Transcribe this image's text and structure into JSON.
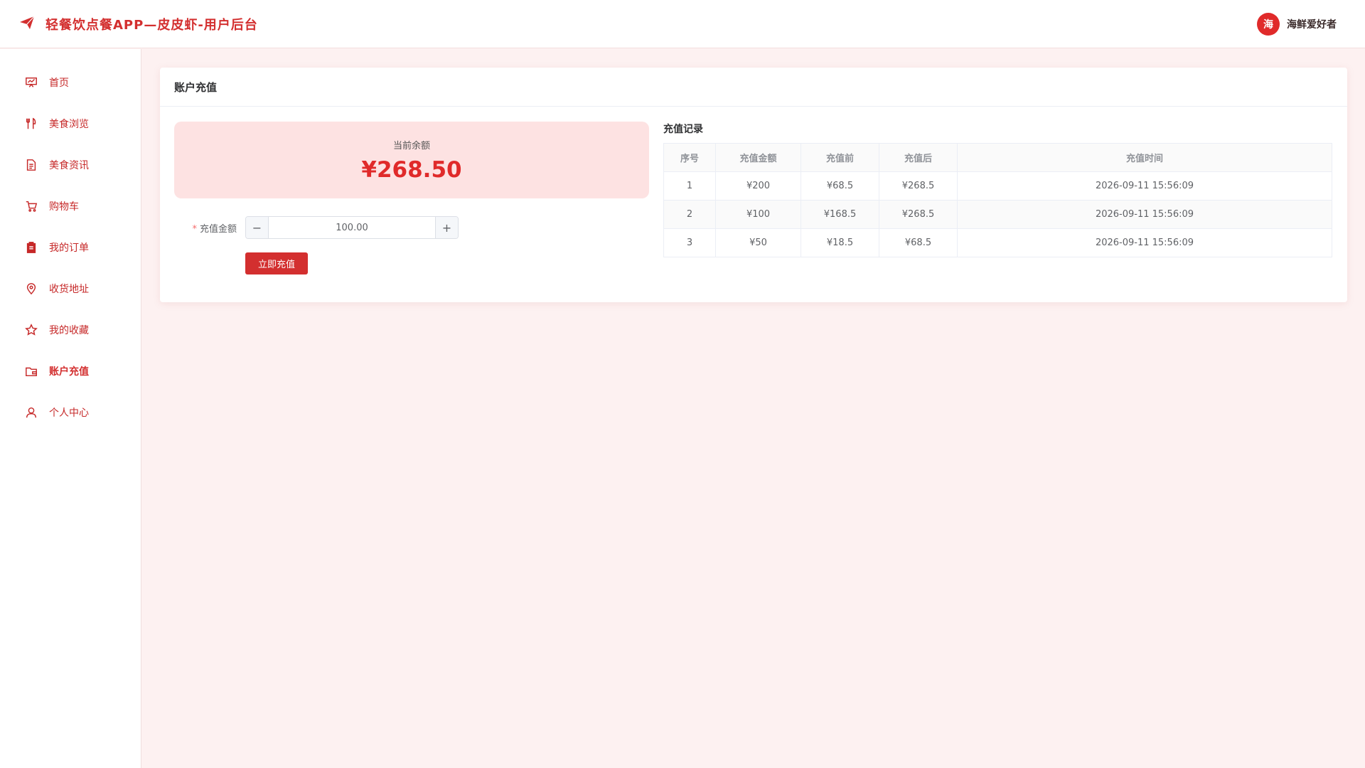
{
  "header": {
    "title": "轻餐饮点餐APP—皮皮虾-用户后台",
    "user": {
      "avatar_text": "海",
      "name": "海鲜爱好者"
    }
  },
  "sidebar": {
    "items": [
      {
        "label": "首页",
        "icon": "chart-board-icon"
      },
      {
        "label": "美食浏览",
        "icon": "fork-knife-icon"
      },
      {
        "label": "美食资讯",
        "icon": "document-icon"
      },
      {
        "label": "购物车",
        "icon": "cart-icon"
      },
      {
        "label": "我的订单",
        "icon": "clipboard-icon"
      },
      {
        "label": "收货地址",
        "icon": "location-pin-icon"
      },
      {
        "label": "我的收藏",
        "icon": "star-icon"
      },
      {
        "label": "账户充值",
        "icon": "wallet-icon",
        "active": true
      },
      {
        "label": "个人中心",
        "icon": "user-icon"
      }
    ]
  },
  "main": {
    "card_title": "账户充值",
    "balance": {
      "label": "当前余额",
      "value": "¥268.50"
    },
    "form": {
      "amount_label": "充值金额",
      "amount_value": "100.00",
      "minus": "−",
      "plus": "+",
      "submit_label": "立即充值"
    },
    "records": {
      "title": "充值记录",
      "columns": [
        "序号",
        "充值金额",
        "充值前",
        "充值后",
        "充值时间"
      ],
      "rows": [
        [
          "1",
          "¥200",
          "¥68.5",
          "¥268.5",
          "2026-09-11 15:56:09"
        ],
        [
          "2",
          "¥100",
          "¥168.5",
          "¥268.5",
          "2026-09-11 15:56:09"
        ],
        [
          "3",
          "¥50",
          "¥18.5",
          "¥68.5",
          "2026-09-11 15:56:09"
        ]
      ]
    }
  },
  "colors": {
    "accent": "#d32f2f",
    "page_bg": "#fdf1f1",
    "balance_bg": "#fde2e2"
  }
}
